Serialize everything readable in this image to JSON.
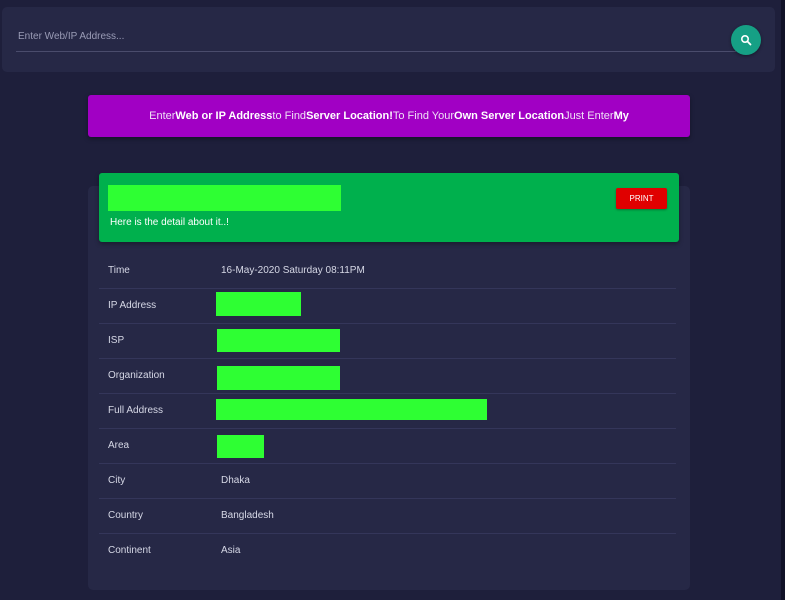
{
  "search": {
    "placeholder": "Enter Web/IP Address...",
    "button_icon": "search-icon"
  },
  "banner": {
    "t1": "Enter ",
    "b1": "Web or IP Address",
    "t2": " to Find ",
    "b2": "Server Location!",
    "t3": " To Find Your ",
    "b3": "Own Server Location",
    "t4": " Just Enter ",
    "b4": "My"
  },
  "details": {
    "subtitle": "Here is the detail about it..!",
    "print_label": "PRINT",
    "rows": [
      {
        "label": "Time",
        "value": "16-May-2020 Saturday 08:11PM"
      },
      {
        "label": "IP Address",
        "value": ""
      },
      {
        "label": "ISP",
        "value": ""
      },
      {
        "label": "Organization",
        "value": ""
      },
      {
        "label": "Full Address",
        "value": ""
      },
      {
        "label": "Area",
        "value": ""
      },
      {
        "label": "City",
        "value": "Dhaka"
      },
      {
        "label": "Country",
        "value": "Bangladesh"
      },
      {
        "label": "Continent",
        "value": "Asia"
      }
    ]
  },
  "colors": {
    "background": "#1e1f3b",
    "card": "#262846",
    "banner": "#a100c4",
    "header": "#00b04d",
    "print": "#e00000",
    "search_button": "#16a085",
    "redaction": "#2eff33"
  }
}
